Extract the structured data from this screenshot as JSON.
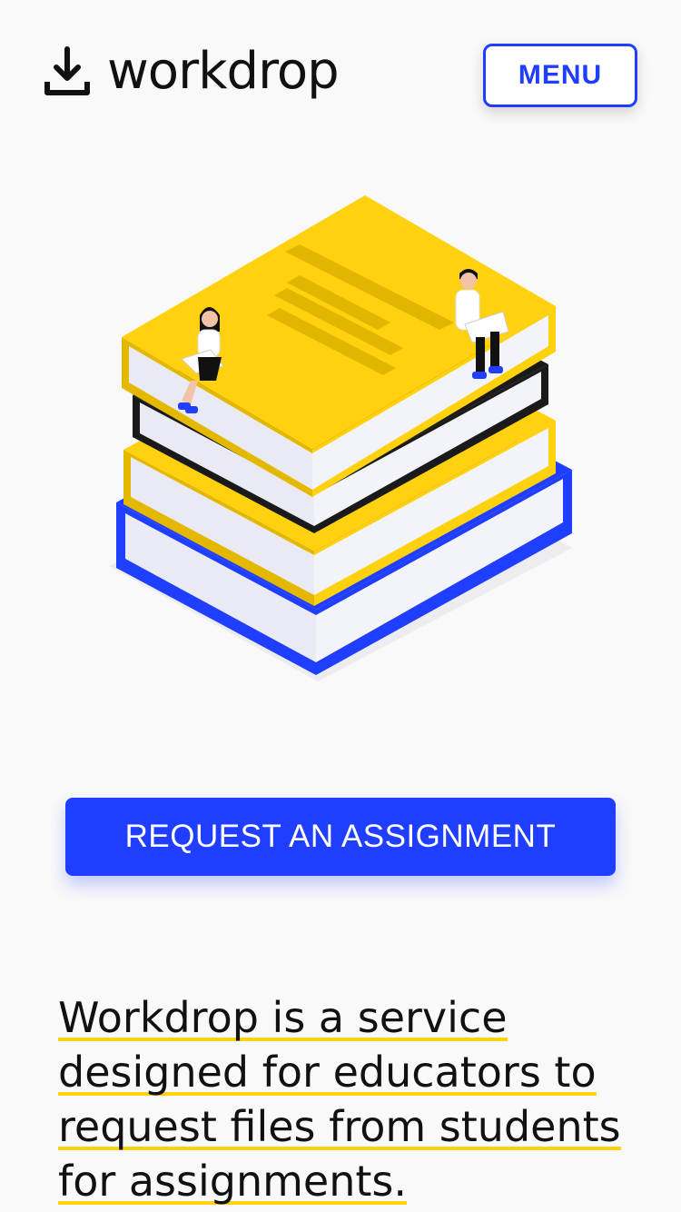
{
  "header": {
    "logo_text": "workdrop",
    "menu_label": "MENU"
  },
  "hero": {
    "illustration": "stack-of-books-with-students-icon"
  },
  "cta": {
    "label": "REQUEST AN ASSIGNMENT"
  },
  "intro": {
    "text": "Workdrop is a service designed for educators to request files from students for assignments."
  },
  "colors": {
    "brand_blue": "#1f3eff",
    "accent_yellow": "#ffd10f",
    "text": "#111111",
    "background": "#f9f9f9"
  }
}
